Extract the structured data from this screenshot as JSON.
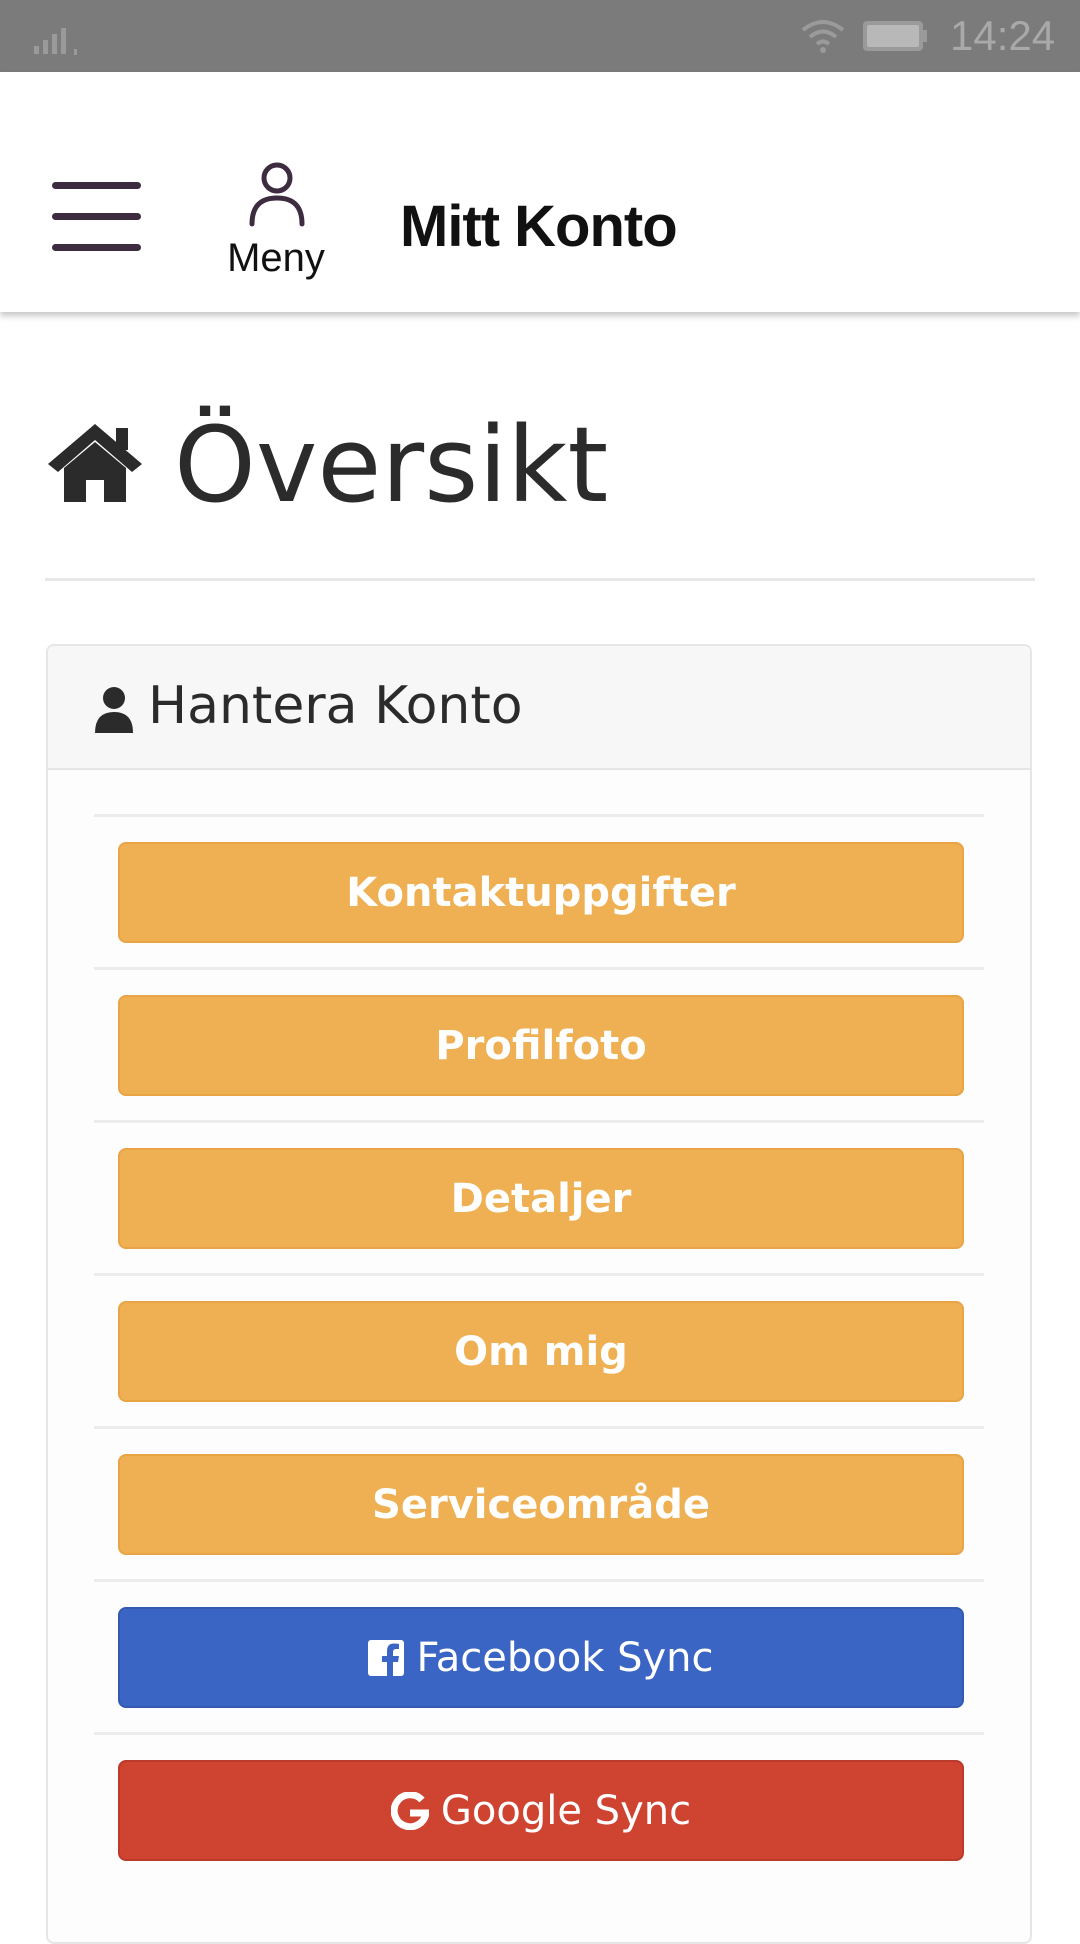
{
  "status_bar": {
    "time": "14:24"
  },
  "header": {
    "menu_label": "Meny",
    "title": "Mitt Konto"
  },
  "page": {
    "title": "Översikt"
  },
  "panel": {
    "title": "Hantera Konto",
    "buttons": [
      {
        "label": "Kontaktuppgifter",
        "style": "orange"
      },
      {
        "label": "Profilfoto",
        "style": "orange"
      },
      {
        "label": "Detaljer",
        "style": "orange"
      },
      {
        "label": "Om mig",
        "style": "orange"
      },
      {
        "label": "Serviceområde",
        "style": "orange"
      },
      {
        "label": "Facebook Sync",
        "style": "facebook",
        "icon": "facebook-icon"
      },
      {
        "label": "Google Sync",
        "style": "google",
        "icon": "google-icon"
      }
    ]
  },
  "colors": {
    "orange": "#efaf53",
    "facebook": "#3b65c4",
    "google": "#cf4331",
    "hamburger": "#3d2b3f"
  }
}
